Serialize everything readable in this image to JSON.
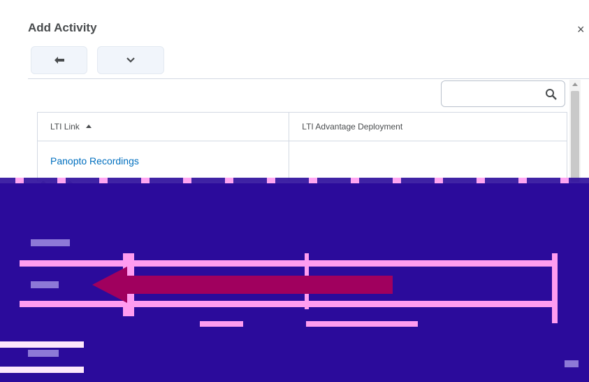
{
  "dialog": {
    "title": "Add Activity",
    "close_glyph": "×"
  },
  "toolbar": {
    "back_icon": "arrow-left-icon",
    "more_icon": "chevron-down-icon"
  },
  "search": {
    "placeholder": "",
    "value": "",
    "icon": "search-icon"
  },
  "table": {
    "columns": [
      "LTI Link",
      "LTI Advantage Deployment"
    ],
    "sort_indicator": "ascending",
    "rows": [
      {
        "link": "Panopto Recordings",
        "deployment": ""
      }
    ]
  },
  "colors": {
    "link": "#006fbf",
    "button_bg": "#f1f5fb",
    "corruption_bg": "#2b0b9b",
    "corruption_arrow": "#a0005e"
  }
}
